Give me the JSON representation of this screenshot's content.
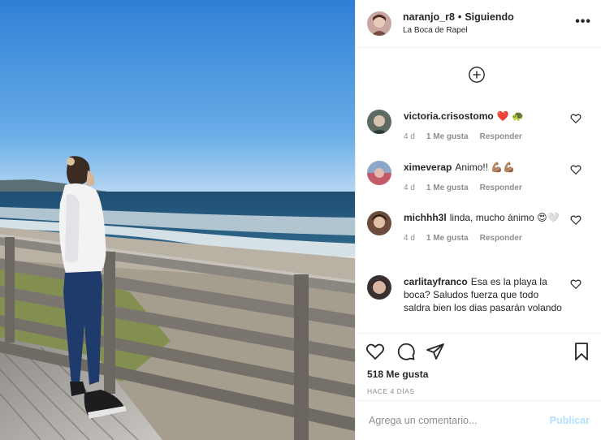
{
  "colors": {
    "accent": "#0095f6",
    "publish_disabled": "#b2dffc",
    "heart_red": "#ed4956",
    "muted": "#8e8e8e"
  },
  "header": {
    "username": "naranjo_r8",
    "separator": "•",
    "follow_status": "Siguiendo",
    "location": "La Boca de Rapel",
    "more_icon": "ellipsis-icon"
  },
  "load_more_icon": "plus-circle-icon",
  "comments": [
    {
      "user": "victoria.crisostomo",
      "text": "❤️ 🐢",
      "age": "4 d",
      "likes": "1 Me gusta",
      "reply": "Responder"
    },
    {
      "user": "ximeverap",
      "text": "Animo!! 💪🏽💪🏽",
      "age": "4 d",
      "likes": "1 Me gusta",
      "reply": "Responder"
    },
    {
      "user": "michhh3l",
      "text": "linda, mucho ánimo 😍🤍",
      "age": "4 d",
      "likes": "1 Me gusta",
      "reply": "Responder"
    },
    {
      "user": "carlitayfranco",
      "text": "Esa es la playa la boca? Saludos fuerza que todo saldra bien los dias pasarán volando",
      "age": "",
      "likes": "",
      "reply": ""
    }
  ],
  "actions": {
    "like_icon": "heart-icon",
    "comment_icon": "comment-icon",
    "share_icon": "paper-plane-icon",
    "save_icon": "bookmark-icon"
  },
  "likes": "518 Me gusta",
  "posted_ago": "HACE 4 DÍAS",
  "add_comment": {
    "placeholder": "Agrega un comentario...",
    "publish_label": "Publicar"
  }
}
